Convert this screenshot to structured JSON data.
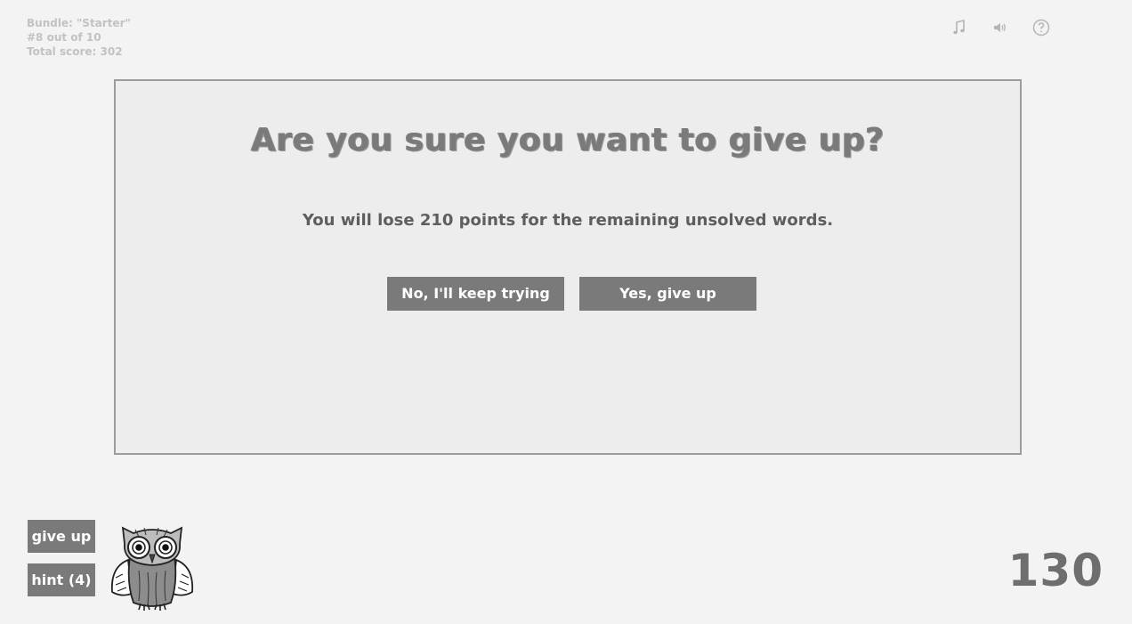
{
  "info": {
    "bundle": "Bundle: \"Starter\"",
    "progress": "#8 out of 10",
    "total_score": "Total score: 302"
  },
  "top_icons": [
    "music-icon",
    "sound-icon",
    "help-icon"
  ],
  "modal": {
    "title": "Are you sure you want to give up?",
    "message": "You will lose 210 points for the remaining unsolved words.",
    "no_label": "No, I'll keep trying",
    "yes_label": "Yes, give up"
  },
  "controls": {
    "give_up_label": "give up",
    "hint_label": "hint (4)"
  },
  "score": "130",
  "colors": {
    "background": "#f3f3f3",
    "modal_background": "#ededed",
    "modal_border": "#9c9c9c",
    "button": "#7a7a7a",
    "button_text": "#ffffff",
    "info_text": "#c2c2c2"
  }
}
